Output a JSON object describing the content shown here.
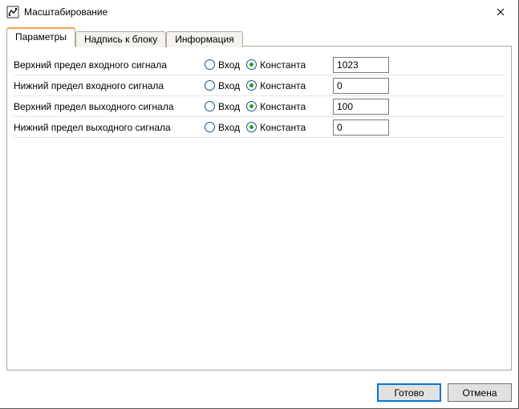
{
  "window": {
    "title": "Масштабирование"
  },
  "tabs": [
    {
      "label": "Параметры",
      "active": true
    },
    {
      "label": "Надпись к блоку",
      "active": false
    },
    {
      "label": "Информация",
      "active": false
    }
  ],
  "radio_labels": {
    "input": "Вход",
    "constant": "Константа"
  },
  "params": [
    {
      "label": "Верхний предел входного сигнала",
      "selected": "constant",
      "value": "1023"
    },
    {
      "label": "Нижний предел входного сигнала",
      "selected": "constant",
      "value": "0"
    },
    {
      "label": "Верхний предел выходного сигнала",
      "selected": "constant",
      "value": "100"
    },
    {
      "label": "Нижний предел выходного сигнала",
      "selected": "constant",
      "value": "0"
    }
  ],
  "buttons": {
    "ok": "Готово",
    "cancel": "Отмена"
  }
}
